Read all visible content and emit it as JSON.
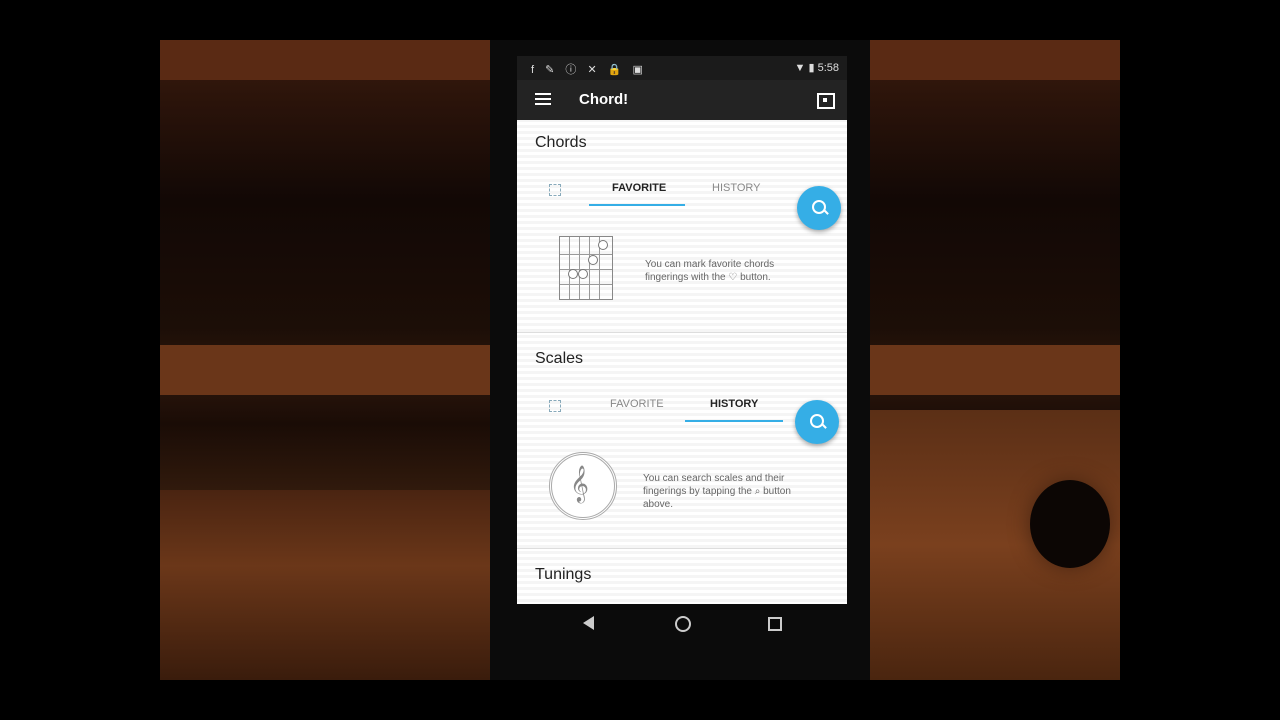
{
  "status_bar": {
    "icons": "f ✎ ⓘ ✕ 🔒 ▣",
    "time": "5:58"
  },
  "app_bar": {
    "title": "Chord!"
  },
  "sections": {
    "chords": {
      "title": "Chords",
      "tabs": [
        "FAVORITE",
        "HISTORY"
      ],
      "active_tab": "FAVORITE",
      "message": "You can mark favorite chords fingerings with the ♡ button."
    },
    "scales": {
      "title": "Scales",
      "tabs": [
        "FAVORITE",
        "HISTORY"
      ],
      "active_tab": "HISTORY",
      "message": "You can search scales and their fingerings by tapping the ⌕ button above."
    },
    "tunings": {
      "title": "Tunings"
    }
  },
  "accent_color": "#35aee6"
}
